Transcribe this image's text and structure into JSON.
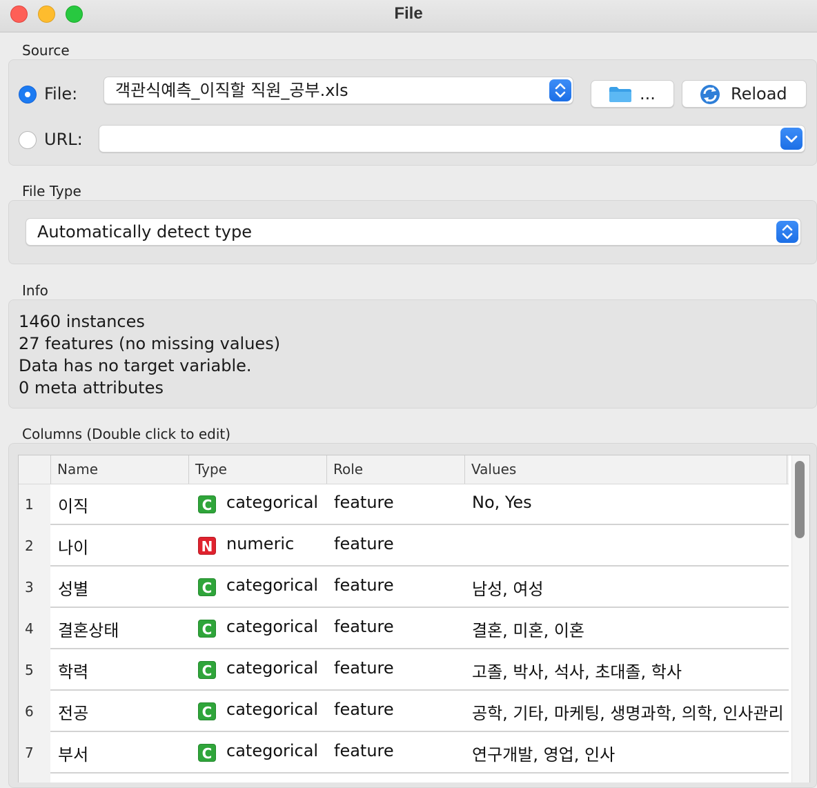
{
  "window": {
    "title": "File"
  },
  "source": {
    "label": "Source",
    "file_label": "File:",
    "file_value": "객관식예측_이직할 직원_공부.xls",
    "browse_label": "...",
    "reload_label": "Reload",
    "url_label": "URL:",
    "url_value": ""
  },
  "file_type": {
    "label": "File Type",
    "value": "Automatically detect type"
  },
  "info": {
    "label": "Info",
    "lines": [
      "1460 instances",
      "27 features (no missing values)",
      "Data has no target variable.",
      "0 meta attributes"
    ]
  },
  "columns": {
    "label": "Columns (Double click to edit)",
    "headers": [
      "Name",
      "Type",
      "Role",
      "Values"
    ],
    "rows": [
      {
        "num": "1",
        "name": "이직",
        "badge": "C",
        "type": "categorical",
        "role": "feature",
        "values": "No, Yes"
      },
      {
        "num": "2",
        "name": "나이",
        "badge": "N",
        "type": "numeric",
        "role": "feature",
        "values": ""
      },
      {
        "num": "3",
        "name": "성별",
        "badge": "C",
        "type": "categorical",
        "role": "feature",
        "values": "남성, 여성"
      },
      {
        "num": "4",
        "name": "결혼상태",
        "badge": "C",
        "type": "categorical",
        "role": "feature",
        "values": "결혼, 미혼, 이혼"
      },
      {
        "num": "5",
        "name": "학력",
        "badge": "C",
        "type": "categorical",
        "role": "feature",
        "values": "고졸, 박사, 석사, 초대졸, 학사"
      },
      {
        "num": "6",
        "name": "전공",
        "badge": "C",
        "type": "categorical",
        "role": "feature",
        "values": "공학, 기타, 마케팅, 생명과학, 의학, 인사관리"
      },
      {
        "num": "7",
        "name": "부서",
        "badge": "C",
        "type": "categorical",
        "role": "feature",
        "values": "연구개발, 영업, 인사"
      },
      {
        "num": "8",
        "name": "",
        "badge": "",
        "type": "",
        "role": "",
        "values": ""
      }
    ]
  },
  "colors": {
    "accent": "#1c7bf2",
    "categorical": "#2fa53a",
    "numeric": "#e0222e"
  },
  "icons": {
    "browse": "folder-icon",
    "reload": "reload-icon",
    "stepper": "updown-chevron-icon",
    "url_dropdown": "chevron-down-icon"
  }
}
